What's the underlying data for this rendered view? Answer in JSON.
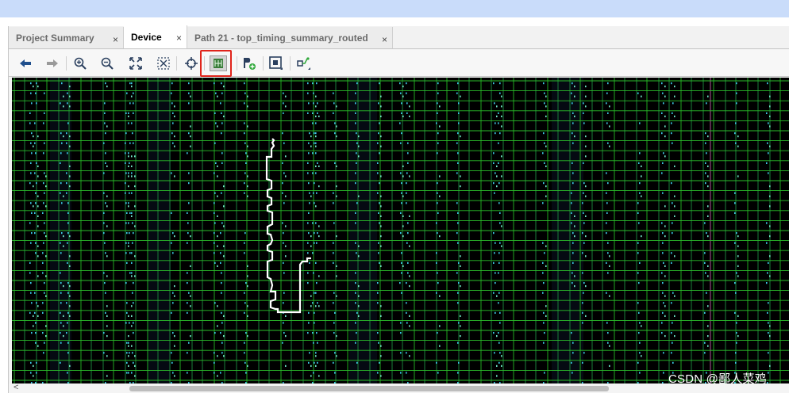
{
  "tabs": [
    {
      "label": "Project Summary",
      "active": false
    },
    {
      "label": "Device",
      "active": true
    },
    {
      "label": "Path 21 - top_timing_summary_routed",
      "active": false
    }
  ],
  "tab_close_glyph": "×",
  "toolbar": {
    "buttons": [
      {
        "icon": "back-arrow-icon"
      },
      {
        "icon": "forward-arrow-icon"
      },
      {
        "icon": "zoom-in-icon"
      },
      {
        "icon": "zoom-out-icon"
      },
      {
        "icon": "zoom-fit-icon"
      },
      {
        "icon": "zoom-to-selected-icon"
      },
      {
        "icon": "crosshair-icon"
      },
      {
        "icon": "routing-resources-icon",
        "pressed": true,
        "highlighted": true
      },
      {
        "icon": "add-pblock-icon"
      },
      {
        "icon": "select-region-icon"
      },
      {
        "icon": "route-toggle-icon"
      }
    ]
  },
  "colors": {
    "grid": "#2bbf2b",
    "canvas_bg": "#000000",
    "cells": "#3ec8e6",
    "route": "#ffffff",
    "highlight": "#e0241b",
    "tabbar_top": "#c9dcfa"
  },
  "scroll": {
    "left_arrow": "<"
  },
  "watermark": "CSDN @鄙人菜鸡"
}
